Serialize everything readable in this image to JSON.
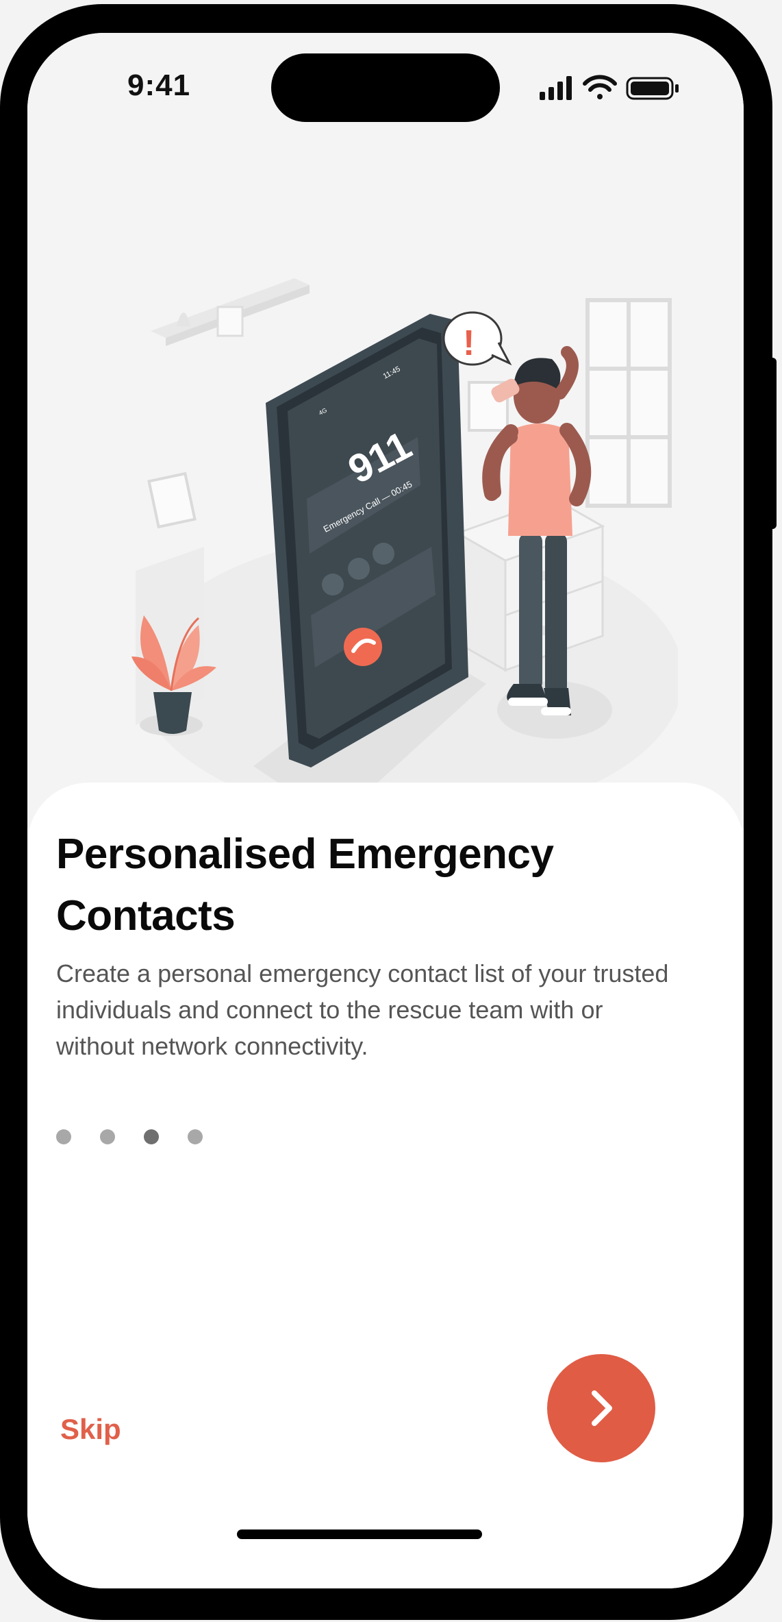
{
  "status_bar": {
    "time": "9:41",
    "icons": [
      "cellular-signal-icon",
      "wifi-icon",
      "battery-icon"
    ]
  },
  "illustration": {
    "phone_screen": {
      "number": "911",
      "call_label": "Emergency Call — 00:45",
      "time": "11:45",
      "network": "4G"
    },
    "speech_bubble": "!"
  },
  "onboarding": {
    "title": "Personalised Emergency Contacts",
    "description": "Create a personal emergency contact list of your trusted individuals and connect to the rescue team with or without network connectivity.",
    "page_count": 4,
    "active_page": 3
  },
  "actions": {
    "skip_label": "Skip",
    "next_icon": "chevron-right-icon"
  },
  "colors": {
    "accent": "#e05c45",
    "title": "#0a0a0a",
    "body_text": "#555555",
    "dot_inactive": "#a8a8a8",
    "dot_active": "#6f6f6f"
  }
}
